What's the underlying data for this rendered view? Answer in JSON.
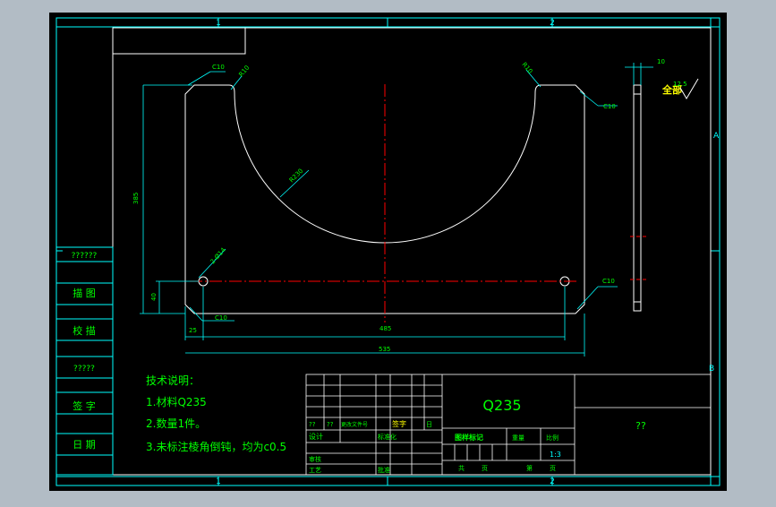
{
  "colors": {
    "background_outer": "#b2bcc5",
    "canvas": "#000000",
    "frame": "#00ffff",
    "geometry": "#ffffff",
    "centerline": "#ff0000",
    "dimension": "#00ffff",
    "text_green": "#00ff00",
    "text_yellow": "#ffff00"
  },
  "zones": {
    "top_1": "1",
    "top_2": "2",
    "bottom_1": "1",
    "bottom_2": "2",
    "right_a": "A",
    "right_b": "B"
  },
  "dimensions": {
    "c10_top_left": "C10",
    "r10_top_left": "R10",
    "r10_top_right": "R10",
    "c10_top_right": "C10",
    "r_arc": "R230",
    "height_385": "385",
    "hole_spec": "2-Ø14",
    "height_40": "40",
    "c10_bottom_left": "C10",
    "c10_bottom_right": "C10",
    "left_25": "25",
    "span_485": "485",
    "total_535": "535",
    "thickness_10": "10",
    "roughness": "全部",
    "roughness_value": "12.5"
  },
  "left_block": {
    "row1": "??????",
    "row2": "描 图",
    "row3": "校 描",
    "row4": "?????",
    "row5": "签 字",
    "row6": "日 期"
  },
  "notes": {
    "heading": "技术说明：",
    "line1": "1.材料Q235",
    "line2": "2.数量1件。",
    "line3": "3.未标注棱角倒钝，均为c0.5"
  },
  "title_block": {
    "material": "Q235",
    "name": "??",
    "cell_q1": "??",
    "cell_q2": "??",
    "cell_wenjian": "更改文件号",
    "cell_qianzi": "签字",
    "cell_riqi": "日",
    "design": "设计",
    "standard": "标准化",
    "check": "审核",
    "process": "工艺",
    "approve": "批准",
    "stage_mark": "图样标记",
    "weight": "重量",
    "scale": "比例",
    "scale_value": "1:3",
    "sheets_total": "共",
    "sheet_page": "页",
    "sheet_no": "第",
    "sheet_page2": "页"
  }
}
